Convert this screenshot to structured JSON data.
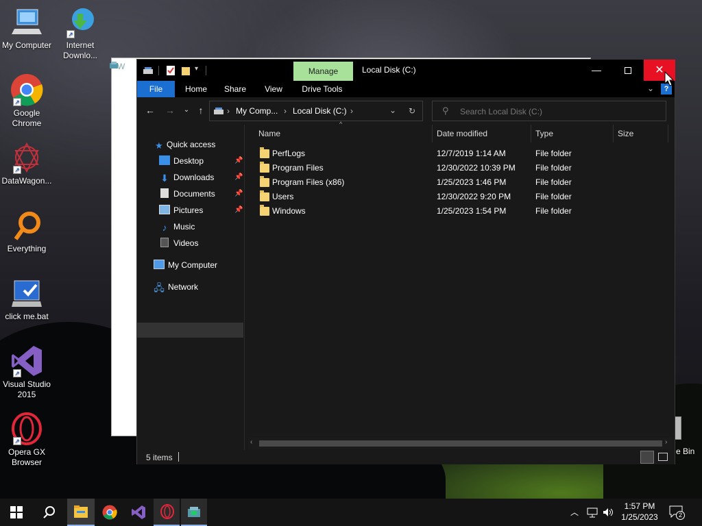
{
  "desktop": {
    "icons": [
      {
        "label": "My Computer",
        "icon": "computer-icon"
      },
      {
        "label": "Internet Downlo...",
        "icon": "idm-icon"
      },
      {
        "label": "Google Chrome",
        "icon": "chrome-icon"
      },
      {
        "label": "DataWagon...",
        "icon": "datawagon-icon"
      },
      {
        "label": "Everything",
        "icon": "everything-icon"
      },
      {
        "label": "click me.bat",
        "icon": "bat-file-icon"
      },
      {
        "label": "Visual Studio 2015",
        "icon": "visual-studio-icon"
      },
      {
        "label": "Opera GX Browser",
        "icon": "opera-gx-icon"
      }
    ],
    "recycle_partial": "e Bin"
  },
  "background_window": {
    "title_partial": "W"
  },
  "explorer": {
    "title": "Local Disk (C:)",
    "manage_tab": "Manage",
    "ribbon_tabs": [
      "File",
      "Home",
      "Share",
      "View",
      "Drive Tools"
    ],
    "breadcrumb": [
      "My Comp...",
      "Local Disk (C:)"
    ],
    "search_placeholder": "Search Local Disk (C:)",
    "nav": {
      "quick_access": "Quick access",
      "pinned": [
        "Desktop",
        "Downloads",
        "Documents",
        "Pictures"
      ],
      "unpinned": [
        "Music",
        "Videos"
      ],
      "my_computer": "My Computer",
      "network": "Network"
    },
    "columns": [
      "Name",
      "Date modified",
      "Type",
      "Size"
    ],
    "files": [
      {
        "name": "PerfLogs",
        "date": "12/7/2019 1:14 AM",
        "type": "File folder"
      },
      {
        "name": "Program Files",
        "date": "12/30/2022 10:39 PM",
        "type": "File folder"
      },
      {
        "name": "Program Files (x86)",
        "date": "1/25/2023 1:46 PM",
        "type": "File folder"
      },
      {
        "name": "Users",
        "date": "12/30/2022 9:20 PM",
        "type": "File folder"
      },
      {
        "name": "Windows",
        "date": "1/25/2023 1:54 PM",
        "type": "File folder"
      }
    ],
    "status": "5 items"
  },
  "taskbar": {
    "time": "1:57 PM",
    "date": "1/25/2023",
    "notification_count": "2"
  },
  "colors": {
    "accent": "#1a6fd0",
    "close": "#e81123",
    "manage": "#a8e29a",
    "folder": "#f5d372"
  }
}
